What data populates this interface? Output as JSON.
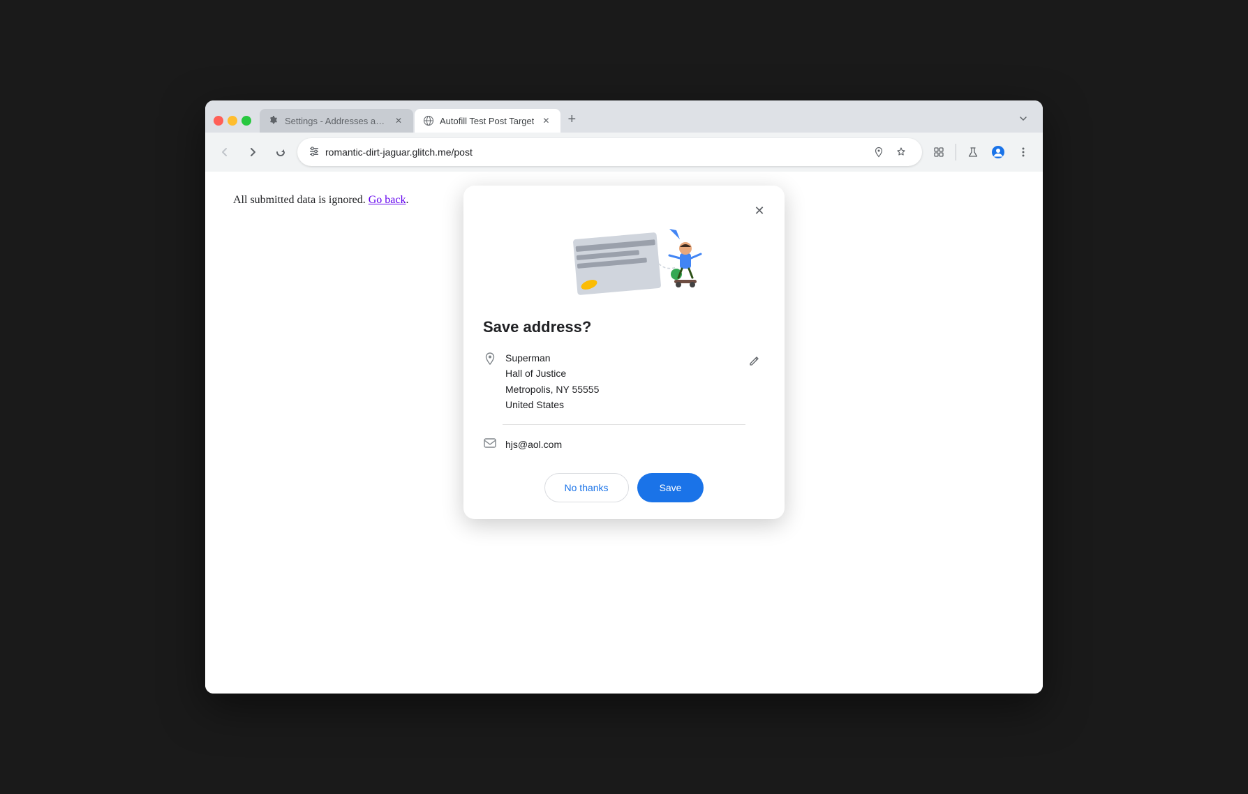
{
  "browser": {
    "tabs": [
      {
        "id": "settings-tab",
        "title": "Settings - Addresses and mo",
        "icon": "gear",
        "active": false
      },
      {
        "id": "autofill-tab",
        "title": "Autofill Test Post Target",
        "icon": "globe",
        "active": true
      }
    ],
    "address_bar": {
      "url": "romantic-dirt-jaguar.glitch.me/post",
      "security_label": "Site information"
    }
  },
  "page": {
    "main_text": "All submitted data is ignored.",
    "link_text": "Go back",
    "link_suffix": "."
  },
  "dialog": {
    "title": "Save address?",
    "close_label": "×",
    "address": {
      "name": "Superman",
      "line1": "Hall of Justice",
      "line2": "Metropolis, NY 55555",
      "country": "United States"
    },
    "email": "hjs@aol.com",
    "actions": {
      "no_thanks": "No thanks",
      "save": "Save"
    }
  },
  "toolbar": {
    "back_label": "←",
    "forward_label": "→",
    "reload_label": "↻",
    "bookmark_label": "☆",
    "more_label": "⋮"
  }
}
